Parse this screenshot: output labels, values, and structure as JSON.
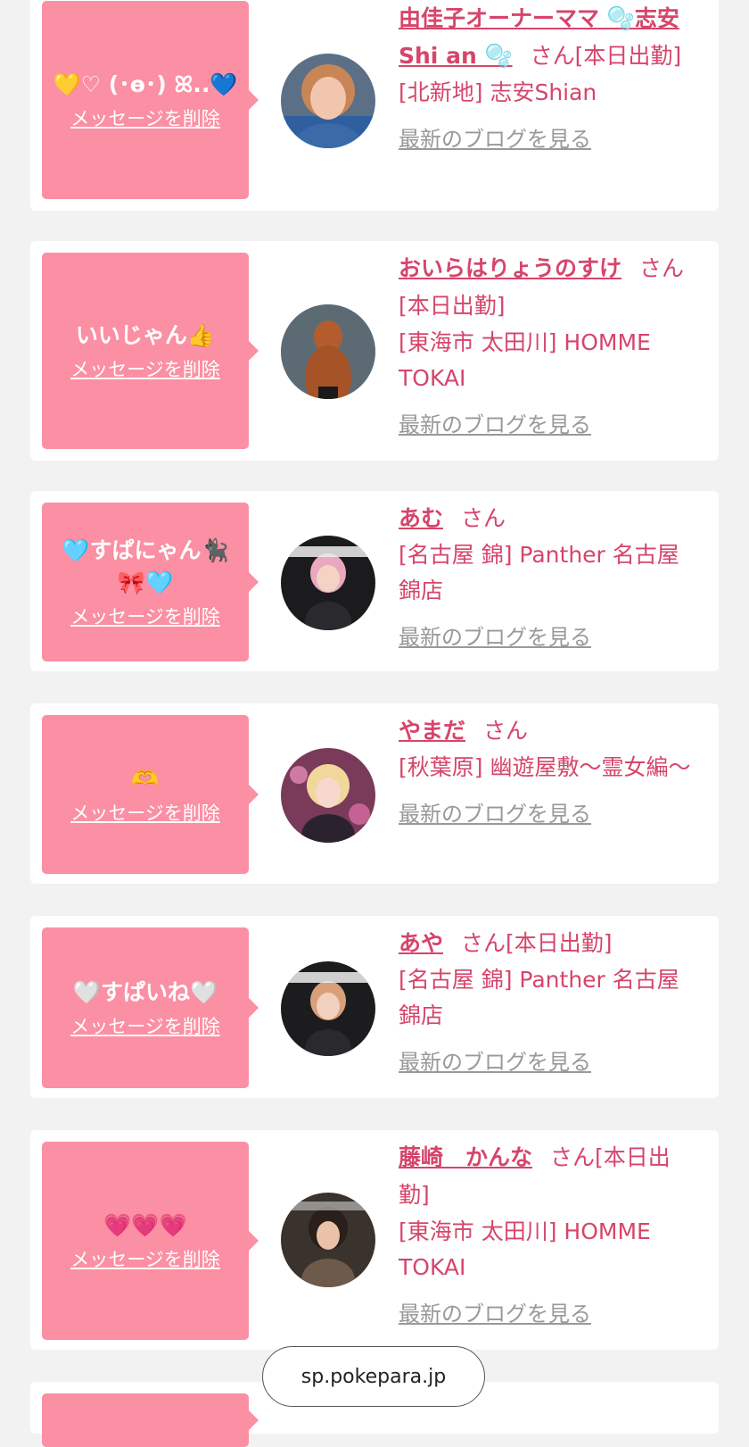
{
  "delete_label": "メッセージを削除",
  "honorific": "さん",
  "blog_label": "最新のブログを見る",
  "url": "sp.pokepara.jp",
  "cards": [
    {
      "message": "💛♡ (･ɵ･) ꕤ..💙",
      "name": "由佳子オーナーママ 🫧志安 Shi an 🫧",
      "suffix": "[本日出勤]",
      "shop": "[北新地] 志安Shian"
    },
    {
      "message": "いいじゃん👍",
      "name": "おいらはりょうのすけ",
      "suffix": "[本日出勤]",
      "shop": "[東海市 太田川] HOMME TOKAI"
    },
    {
      "message": "🩵すぱにゃん🐈‍⬛🎀🩵",
      "name": "あむ",
      "suffix": "",
      "shop": "[名古屋 錦] Panther 名古屋錦店"
    },
    {
      "message": "🫶",
      "name": "やまだ",
      "suffix": "",
      "shop": "[秋葉原] 幽遊屋敷〜霊女編〜"
    },
    {
      "message": "🤍すぱいね🤍",
      "name": "あや",
      "suffix": "[本日出勤]",
      "shop": "[名古屋 錦] Panther 名古屋錦店"
    },
    {
      "message": "💗💗💗",
      "name": "藤崎　かんな",
      "suffix": "[本日出勤]",
      "shop": "[東海市 太田川] HOMME TOKAI"
    }
  ]
}
